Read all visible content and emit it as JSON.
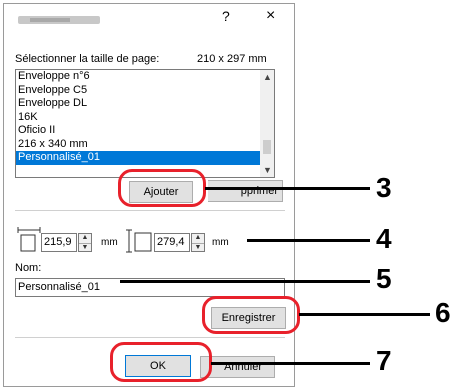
{
  "titlebar": {
    "help": "?",
    "close": "×"
  },
  "page_size": {
    "label": "Sélectionner la taille de page:",
    "value": "210 x 297 mm"
  },
  "list": {
    "items": [
      "Enveloppe n°6",
      "Enveloppe C5",
      "Enveloppe DL",
      "16K",
      "Oficio II",
      "216 x 340 mm",
      "Personnalisé_01"
    ],
    "selected_index": 6
  },
  "buttons": {
    "add": "Ajouter",
    "delete": "pprimer",
    "save": "Enregistrer",
    "ok": "OK",
    "cancel": "Annuler"
  },
  "width": {
    "value": "215,9",
    "unit": "mm"
  },
  "height": {
    "value": "279,4",
    "unit": "mm"
  },
  "name": {
    "label": "Nom:",
    "value": "Personnalisé_01"
  },
  "callouts": [
    "3",
    "4",
    "5",
    "6",
    "7"
  ],
  "colors": {
    "callout_ring": "#e8212b",
    "selection": "#0078d7"
  }
}
